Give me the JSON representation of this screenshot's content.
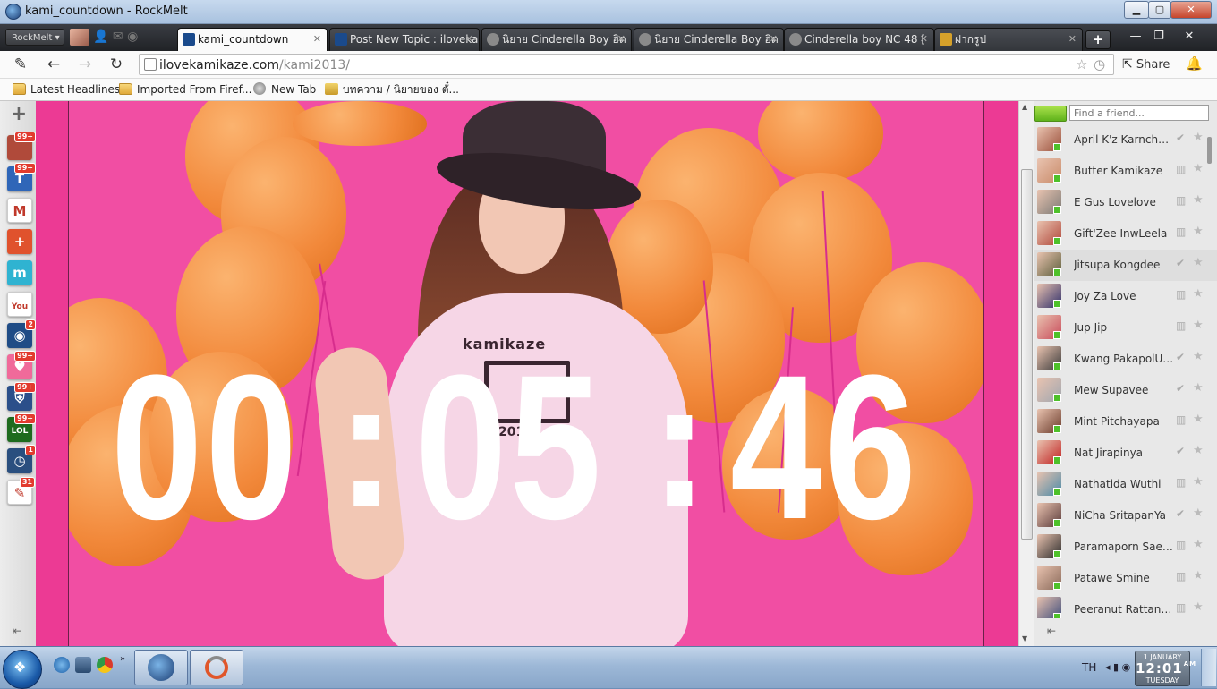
{
  "window": {
    "title": "kami_countdown - RockMelt",
    "min_label": "▁",
    "max_label": "▢",
    "close_label": "✕"
  },
  "tabstrip": {
    "menu_label": "RockMelt ▾",
    "tabs": [
      {
        "label": "kami_countdown",
        "active": true,
        "icon_color": "#1a4a8c"
      },
      {
        "label": "Post New Topic : ilovekamikaze",
        "active": false,
        "icon_color": "#1a4a8c"
      },
      {
        "label": "นิยาย Cinderella Boy ฮิต",
        "active": false,
        "icon_color": "#8a8a8a"
      },
      {
        "label": "นิยาย Cinderella Boy ฮิต",
        "active": false,
        "icon_color": "#8a8a8a"
      },
      {
        "label": "Cinderella boy NC 48 [",
        "active": false,
        "icon_color": "#8a8a8a"
      },
      {
        "label": "ฝากรูป",
        "active": false,
        "icon_color": "#d6a12a"
      }
    ],
    "close_glyph": "✕",
    "new_tab_label": "+",
    "min_glyph": "—",
    "restore_glyph": "❐",
    "close_window_glyph": "✕"
  },
  "toolbar": {
    "url_host": "ilovekamikaze.com",
    "url_path": "/kami2013/",
    "share_label": "Share"
  },
  "bookmarks": [
    {
      "label": "Latest Headlines",
      "icon": "folder-icon"
    },
    {
      "label": "Imported From Firef...",
      "icon": "folder-icon"
    },
    {
      "label": "New Tab",
      "icon": "globe-icon"
    },
    {
      "label": "บทความ / นิยายของ ตั๋...",
      "icon": "dek-d-icon"
    }
  ],
  "apps": [
    {
      "name": "photo-app",
      "badge": "99+",
      "color": "#b04a3a",
      "glyph": ""
    },
    {
      "name": "tweetdeck-app",
      "badge": "99+",
      "color": "#2f66b8",
      "glyph": "T"
    },
    {
      "name": "gmail-app",
      "badge": "",
      "color": "#ffffff",
      "glyph": "M"
    },
    {
      "name": "google-plus-app",
      "badge": "",
      "color": "#e0522d",
      "glyph": "+"
    },
    {
      "name": "meebo-app",
      "badge": "",
      "color": "#2fb3d1",
      "glyph": "m"
    },
    {
      "name": "youtube-app",
      "badge": "",
      "color": "#ffffff",
      "glyph": "You"
    },
    {
      "name": "globe-app",
      "badge": "2",
      "color": "#1f4c86",
      "glyph": "◉"
    },
    {
      "name": "heart-app",
      "badge": "99+",
      "color": "#f06a9a",
      "glyph": "♥"
    },
    {
      "name": "shield-app",
      "badge": "99+",
      "color": "#2b4f8a",
      "glyph": "⛨"
    },
    {
      "name": "lol-app",
      "badge": "99+",
      "color": "#1e6b1e",
      "glyph": "LOL"
    },
    {
      "name": "clock-app",
      "badge": "1",
      "color": "#2a4f7f",
      "glyph": "◷"
    },
    {
      "name": "chat-app",
      "badge": "31",
      "color": "#ffffff",
      "glyph": "✎"
    }
  ],
  "countdown": {
    "hours": "00",
    "minutes": "05",
    "seconds": "46",
    "separator": ":"
  },
  "shirt": {
    "brand": "kamikaze",
    "year": "2013"
  },
  "friends_panel": {
    "search_placeholder": "Find a friend...",
    "friends": [
      {
        "name": "April K'z Karnchan...",
        "checked": true,
        "color": "#9a4f3a"
      },
      {
        "name": "Butter Kamikaze",
        "checked": false,
        "color": "#c98b6a"
      },
      {
        "name": "E Gus Lovelove",
        "checked": false,
        "color": "#7b7a76"
      },
      {
        "name": "Gift'Zee InwLeela",
        "checked": false,
        "color": "#b0473a"
      },
      {
        "name": "Jitsupa Kongdee",
        "checked": true,
        "color": "#5a5d3a"
      },
      {
        "name": "Joy Za Love",
        "checked": false,
        "color": "#2f2f6a"
      },
      {
        "name": "Jup Jip",
        "checked": false,
        "color": "#c84a5a"
      },
      {
        "name": "Kwang PakapolUfo...",
        "checked": true,
        "color": "#3a3a3a"
      },
      {
        "name": "Mew Supavee",
        "checked": true,
        "color": "#a0a7b0"
      },
      {
        "name": "Mint Pitchayapa",
        "checked": false,
        "color": "#6a3a2a"
      },
      {
        "name": "Nat Jirapinya",
        "checked": true,
        "color": "#c02020"
      },
      {
        "name": "Nathatida Wuthi",
        "checked": false,
        "color": "#4a8aa8"
      },
      {
        "name": "NiCha SritapanYa",
        "checked": true,
        "color": "#5a3a3a"
      },
      {
        "name": "Paramaporn Saens...",
        "checked": false,
        "color": "#2a2a2a"
      },
      {
        "name": "Patawe Smine",
        "checked": false,
        "color": "#8a6a5a"
      },
      {
        "name": "Peeranut Rattanak...",
        "checked": false,
        "color": "#3a4a7a"
      }
    ]
  },
  "taskbar": {
    "lang": "TH",
    "clock_date": "1 JANUARY",
    "clock_time": "12:01",
    "clock_ampm": "AM",
    "clock_day": "TUESDAY"
  },
  "colors": {
    "page_background": "#ec3a94",
    "balloon": "#f2893b",
    "countdown_text": "#ffffff",
    "online_status": "#4ec12a"
  }
}
